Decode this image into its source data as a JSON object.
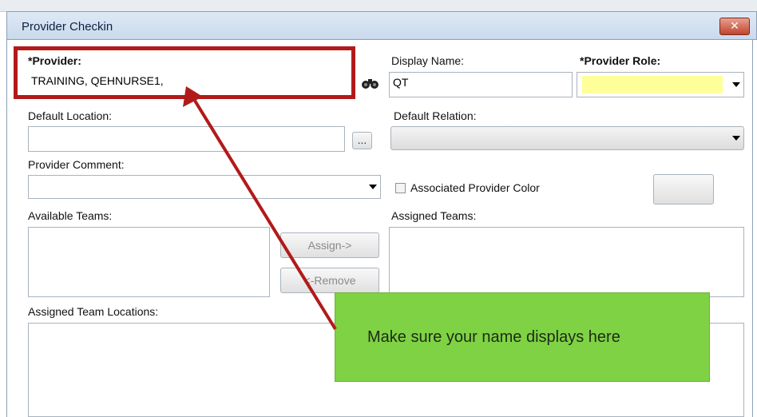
{
  "window": {
    "title": "Provider Checkin",
    "close_label": "✕"
  },
  "provider": {
    "label": "*Provider:",
    "value": "TRAINING, QEHNURSE1,",
    "search_icon": "binoculars-icon"
  },
  "display_name": {
    "label": "Display Name:",
    "value": "QT"
  },
  "provider_role": {
    "label": "*Provider Role:",
    "value": ""
  },
  "default_location": {
    "label": "Default Location:",
    "value": "",
    "browse_label": "..."
  },
  "default_relation": {
    "label": "Default Relation:",
    "value": ""
  },
  "provider_comment": {
    "label": "Provider Comment:",
    "value": ""
  },
  "associated_color": {
    "label": "Associated Provider Color"
  },
  "available_teams": {
    "label": "Available Teams:"
  },
  "assigned_teams": {
    "label": "Assigned Teams:"
  },
  "assign_button": "Assign->",
  "remove_button": "<-Remove",
  "assigned_team_locations": {
    "label": "Assigned Team Locations:"
  },
  "callout": {
    "text": "Make sure your name displays here"
  },
  "colors": {
    "annotation_red": "#b21a1a",
    "callout_green": "#7ed243",
    "required_yellow": "#ffff99"
  }
}
